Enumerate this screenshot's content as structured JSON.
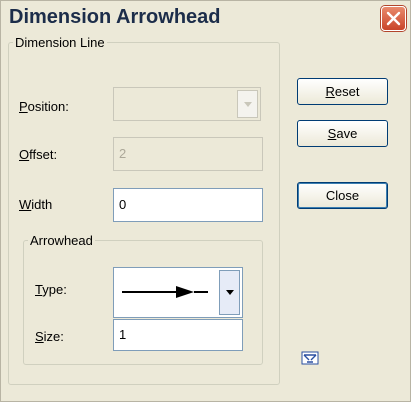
{
  "window": {
    "title": "Dimension Arrowhead"
  },
  "dimension_line": {
    "legend": "Dimension Line",
    "position": {
      "label_hot": "P",
      "label_rest": "osition:",
      "value": ""
    },
    "offset": {
      "label_hot": "O",
      "label_rest": "ffset:",
      "value": "2"
    },
    "width": {
      "label_hot": "W",
      "label_rest": "idth",
      "value": "0"
    }
  },
  "arrowhead": {
    "legend": "Arrowhead",
    "type": {
      "label_hot": "T",
      "label_rest": "ype:",
      "selected_icon": "arrow-line-icon"
    },
    "size": {
      "label_hot": "S",
      "label_rest": "ize:",
      "value": "1"
    }
  },
  "buttons": {
    "reset": {
      "hot": "R",
      "rest": "eset"
    },
    "save": {
      "hot": "S",
      "rest": "ave"
    },
    "close": {
      "label": "Close"
    }
  },
  "icons": {
    "close_window": "close-icon",
    "tool": "settings-tool-icon"
  },
  "colors": {
    "title_text": "#1c2d4a",
    "close_button": "#c9442a",
    "window_bg": "#ece9d8"
  }
}
